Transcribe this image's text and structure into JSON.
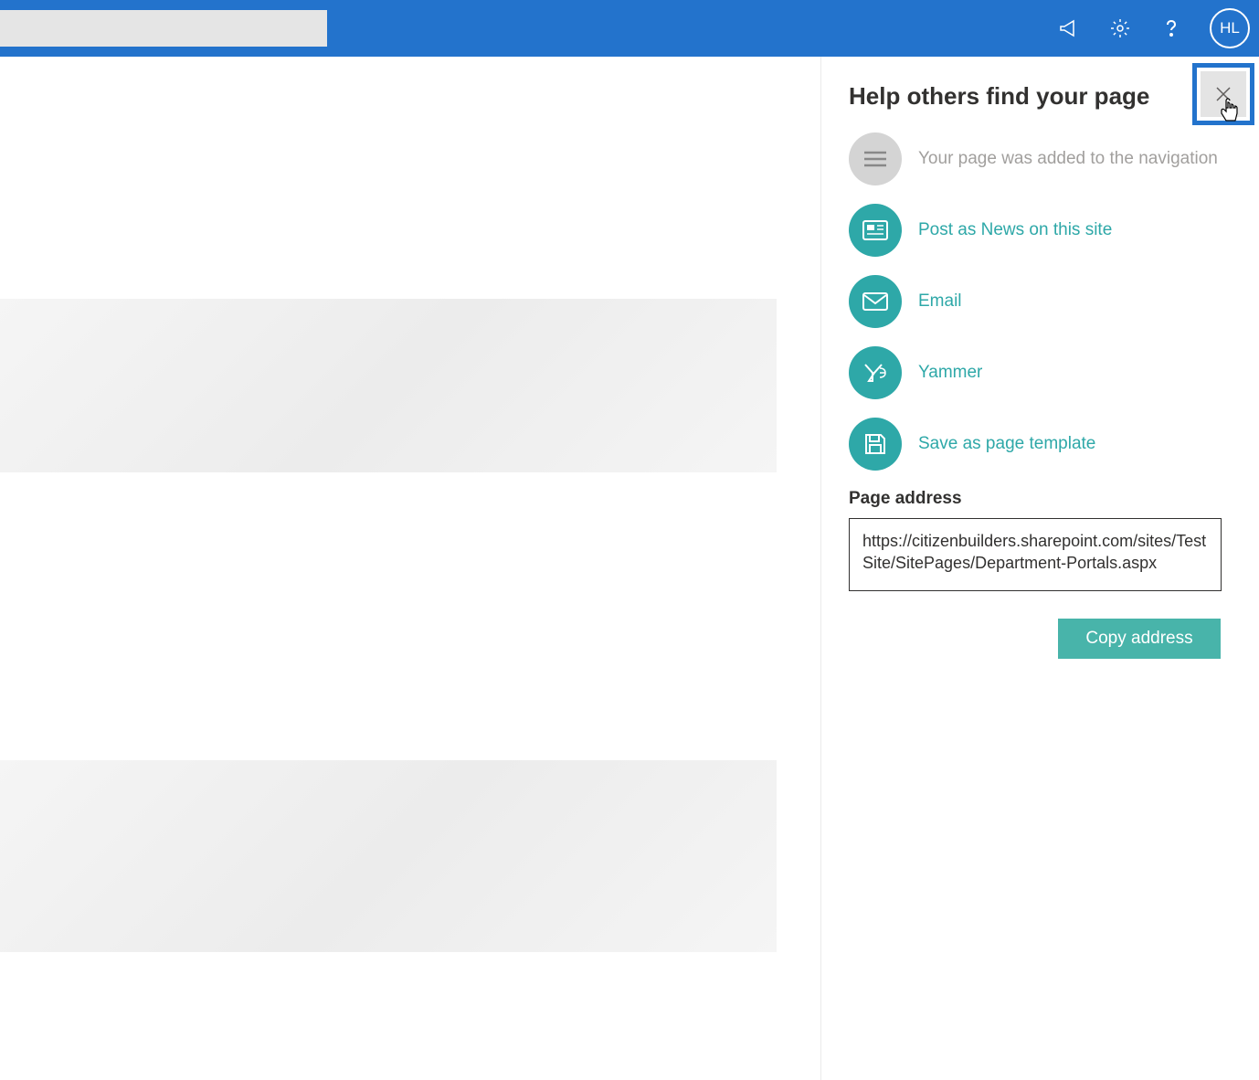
{
  "header": {
    "avatar_initials": "HL"
  },
  "panel": {
    "title": "Help others find your page",
    "options": {
      "navigation": "Your page was added to the navigation",
      "post_news": "Post as News on this site",
      "email": "Email",
      "yammer": "Yammer",
      "save_template": "Save as page template"
    },
    "address_label": "Page address",
    "address_value": "https://citizenbuilders.sharepoint.com/sites/TestSite/SitePages/Department-Portals.aspx",
    "copy_button": "Copy address"
  }
}
